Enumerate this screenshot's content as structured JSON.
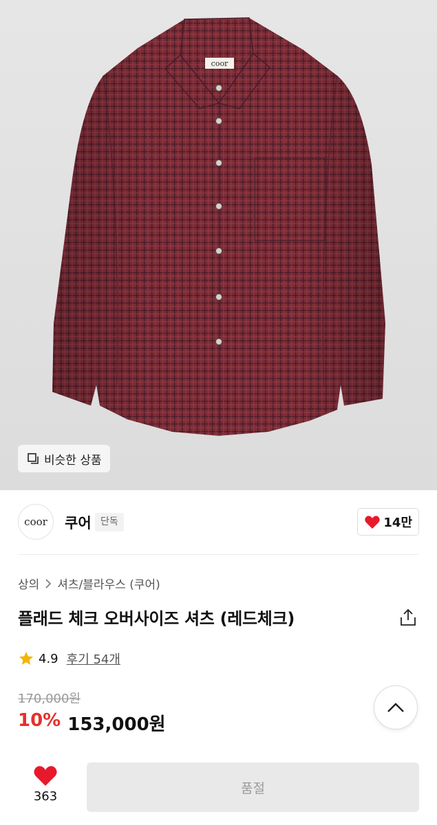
{
  "hero": {
    "similar_label": "비슷한 상품",
    "label_tag": "coor"
  },
  "brand": {
    "logo_text": "coor",
    "name": "쿠어",
    "badge": "단독",
    "likes": "14만"
  },
  "breadcrumb": {
    "category": "상의",
    "subcategory": "셔츠/블라우스 (쿠어)"
  },
  "product": {
    "title": "플래드 체크 오버사이즈 셔츠 (레드체크)",
    "rating": "4.9",
    "reviews_label": "후기 54개",
    "original_price": "170,000원",
    "discount": "10%",
    "price": "153,000원"
  },
  "bottom_bar": {
    "like_count": "363",
    "buy_label": "품절"
  },
  "colors": {
    "accent_red": "#e6302b",
    "heart_red": "#e8192c",
    "star_yellow": "#f5b400",
    "shirt": "#7a2c36"
  },
  "icons": [
    "similar-products-icon",
    "heart-icon",
    "chevron-right-icon",
    "share-icon",
    "star-icon",
    "chevron-up-icon"
  ]
}
